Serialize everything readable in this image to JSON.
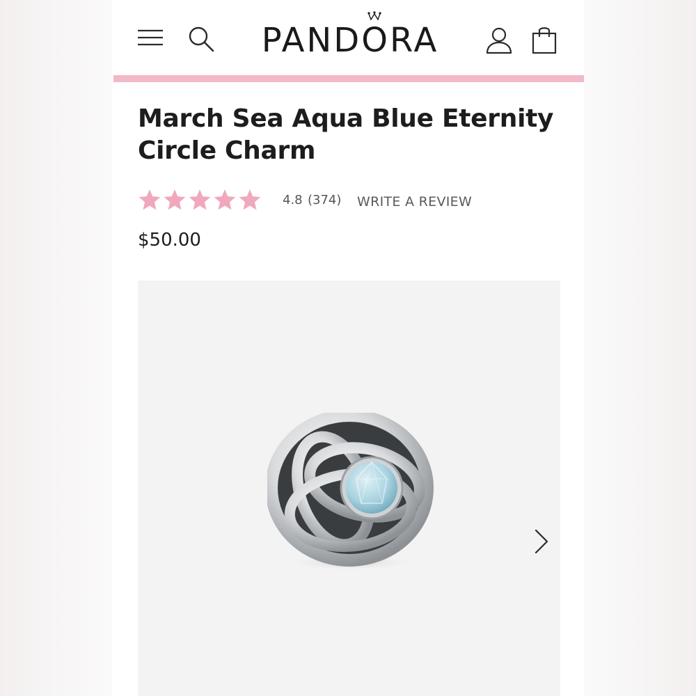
{
  "header": {
    "brand": "PANDORA",
    "icons": {
      "menu": "menu-icon",
      "search": "search-icon",
      "account": "account-icon",
      "bag": "shopping-bag-icon",
      "crown": "crown-icon"
    }
  },
  "colors": {
    "accent_bar": "#f2b8c6",
    "star": "#f0a8bd",
    "text": "#1d1d1d",
    "muted_text": "#555555",
    "gallery_bg": "#f3f3f3",
    "gem": "#a9d3e0"
  },
  "product": {
    "title": "March Sea Aqua Blue Eternity Circle Charm",
    "rating": {
      "stars": 5,
      "value": "4.8",
      "count": "(374)",
      "write_review_label": "WRITE A REVIEW"
    },
    "price": "$50.00"
  },
  "gallery": {
    "image_icon": "charm-image",
    "next_icon": "chevron-right-icon"
  }
}
